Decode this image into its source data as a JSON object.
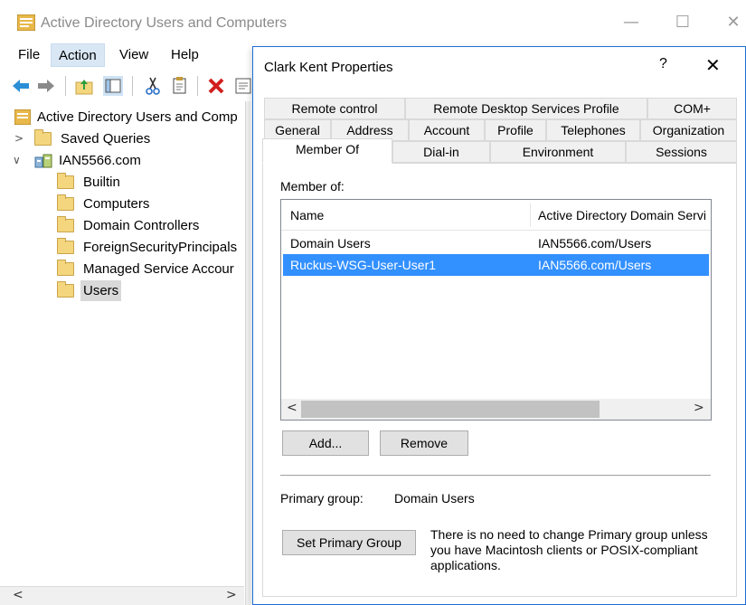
{
  "window": {
    "title": "Active Directory Users and Computers",
    "minimize": "—",
    "maximize": "☐",
    "close": "✕"
  },
  "menu": {
    "items": [
      "File",
      "Action",
      "View",
      "Help"
    ]
  },
  "toolbar": {
    "icons": [
      "back-icon",
      "forward-icon",
      "up-folder-icon",
      "show-hide-tree-icon",
      "cut-icon",
      "copy-icon",
      "delete-icon",
      "properties-icon"
    ]
  },
  "tree": {
    "root": "Active Directory Users and Comp",
    "saved_queries": "Saved Queries",
    "domain": "IAN5566.com",
    "children": [
      "Builtin",
      "Computers",
      "Domain Controllers",
      "ForeignSecurityPrincipals",
      "Managed Service Accour",
      "Users"
    ],
    "expand_collapsed": ">",
    "expand_open": "∨"
  },
  "left_scroll": {
    "left": "<",
    "right": ">"
  },
  "dialog": {
    "title": "Clark Kent Properties",
    "help": "?",
    "close": "✕",
    "tabs": {
      "row1": [
        "Remote control",
        "Remote Desktop Services Profile",
        "COM+"
      ],
      "row2": [
        "General",
        "Address",
        "Account",
        "Profile",
        "Telephones",
        "Organization"
      ],
      "row3": [
        "Member Of",
        "Dial-in",
        "Environment",
        "Sessions"
      ]
    },
    "selected_tab": "Member Of",
    "member_of_label": "Member of:",
    "list": {
      "columns": [
        "Name",
        "Active Directory Domain Servi"
      ],
      "rows": [
        {
          "name": "Domain Users",
          "folder": "IAN5566.com/Users"
        },
        {
          "name": "Ruckus-WSG-User-User1",
          "folder": "IAN5566.com/Users"
        }
      ],
      "scroll_left": "<",
      "scroll_right": ">"
    },
    "add_button": "Add...",
    "remove_button": "Remove",
    "primary_group_label": "Primary group:",
    "primary_group_value": "Domain Users",
    "set_primary_button": "Set Primary Group",
    "note": "There is no need to change Primary group unless you have Macintosh clients or POSIX-compliant applications."
  }
}
